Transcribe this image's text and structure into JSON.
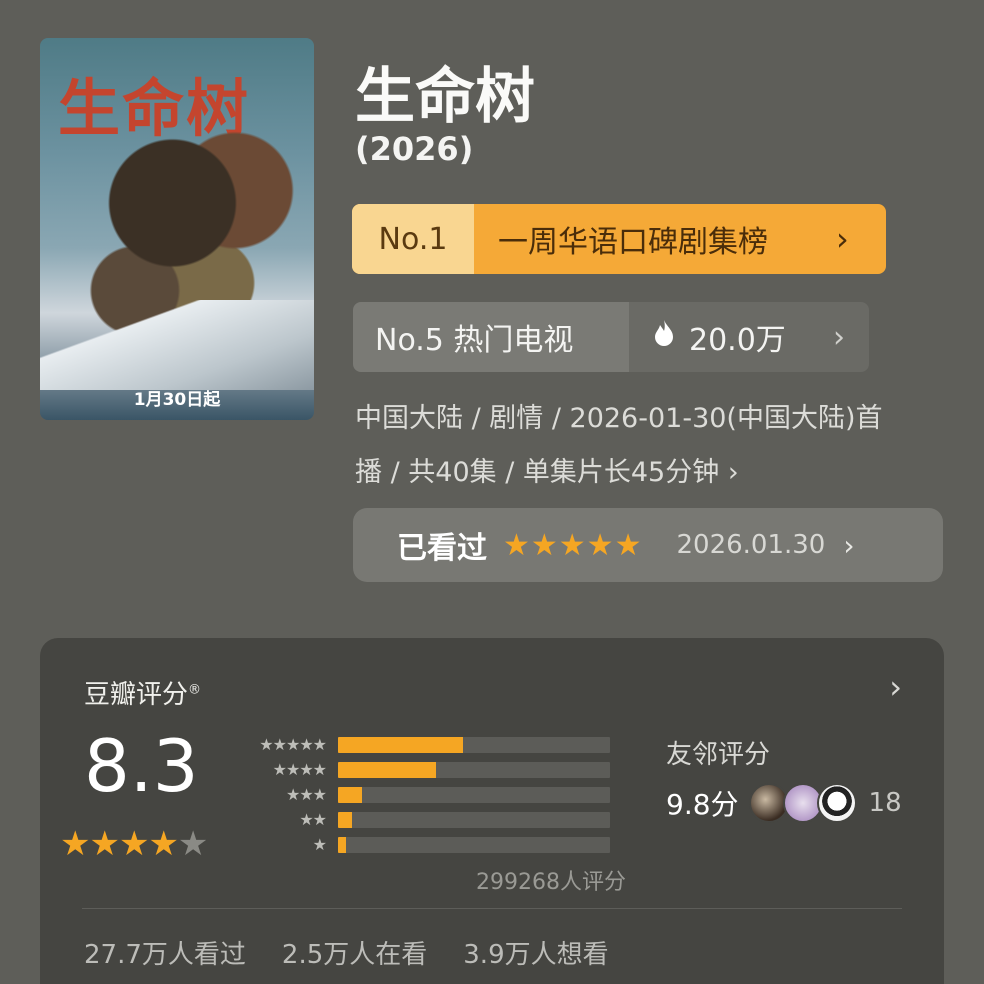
{
  "poster": {
    "title_text": "生命树",
    "date_text": "1月30日起"
  },
  "show": {
    "title": "生命树",
    "year": "(2026)"
  },
  "rank_primary": {
    "number": "No.1",
    "label": "一周华语口碑剧集榜",
    "chevron": "›",
    "colors": {
      "accent": "#f5a937",
      "number_bg": "#f9d691"
    }
  },
  "rank_secondary": {
    "label": "No.5 热门电视",
    "heat_icon": "flame-icon",
    "heat_value": "20.0万",
    "chevron": "›"
  },
  "meta": {
    "line1": "中国大陆 / 剧情 / 2026-01-30(中国大陆)首",
    "line2": "播 / 共40集 / 单集片长45分钟 ›"
  },
  "watched": {
    "label": "已看过",
    "stars": "★★★★★",
    "date": "2026.01.30",
    "chevron": "›",
    "rating": 5
  },
  "douban": {
    "heading": "豆瓣评分",
    "mark": "®",
    "chevron": "›",
    "score": "8.3",
    "stars_on": "★★★★",
    "stars_off": "★",
    "star_rating": 4,
    "distribution": [
      {
        "stars": "★★★★★",
        "fraction": 0.46
      },
      {
        "stars": "★★★★",
        "fraction": 0.36
      },
      {
        "stars": "★★★",
        "fraction": 0.09
      },
      {
        "stars": "★★",
        "fraction": 0.05
      },
      {
        "stars": "★",
        "fraction": 0.03
      }
    ],
    "rating_count": "299268人评分",
    "friends": {
      "label": "友邻评分",
      "score": "9.8分",
      "count": "18"
    },
    "stats": {
      "watched": "27.7万人看过",
      "watching": "2.5万人在看",
      "want": "3.9万人想看"
    },
    "colors": {
      "bar_fill": "#f5a623",
      "bar_track": "#5c5c58"
    }
  }
}
